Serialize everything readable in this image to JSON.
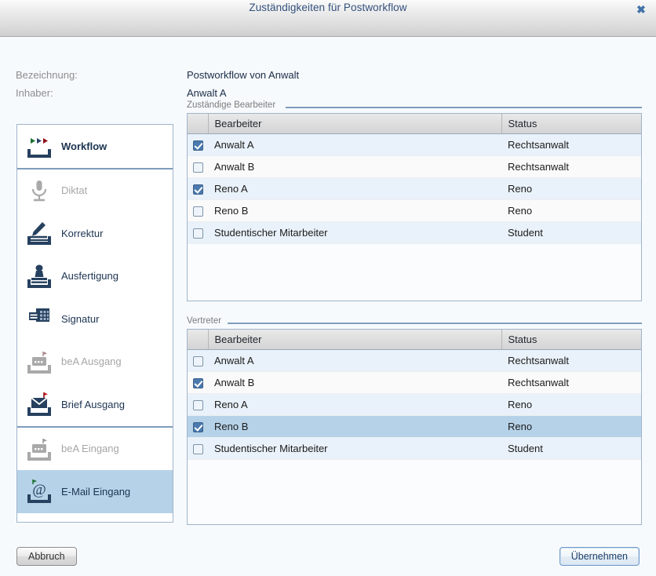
{
  "window": {
    "title": "Zuständigkeiten für Postworkflow",
    "close_icon": "close-icon",
    "close_glyph": "✖"
  },
  "info": {
    "bezeichnung_label": "Bezeichnung:",
    "bezeichnung_value": "Postworkflow von Anwalt",
    "inhaber_label": "Inhaber:",
    "inhaber_value": "Anwalt A"
  },
  "sidebar": {
    "items": [
      {
        "label": "Workflow",
        "icon": "workflow-arrows-icon",
        "state": "active",
        "selected": false,
        "separator_after": true
      },
      {
        "label": "Diktat",
        "icon": "microphone-icon",
        "state": "disabled",
        "selected": false,
        "separator_after": false
      },
      {
        "label": "Korrektur",
        "icon": "pencil-tray-icon",
        "state": "enabled",
        "selected": false,
        "separator_after": false
      },
      {
        "label": "Ausfertigung",
        "icon": "stamp-icon",
        "state": "enabled",
        "selected": false,
        "separator_after": false
      },
      {
        "label": "Signatur",
        "icon": "signature-card-icon",
        "state": "enabled",
        "selected": false,
        "separator_after": false
      },
      {
        "label": "beA Ausgang",
        "icon": "bea-outbox-icon",
        "state": "disabled",
        "selected": false,
        "separator_after": false
      },
      {
        "label": "Brief Ausgang",
        "icon": "envelope-outbox-icon",
        "state": "enabled",
        "selected": false,
        "separator_after": true
      },
      {
        "label": "beA Eingang",
        "icon": "bea-inbox-icon",
        "state": "disabled",
        "selected": false,
        "separator_after": false
      },
      {
        "label": "E-Mail Eingang",
        "icon": "at-inbox-icon",
        "state": "enabled",
        "selected": true,
        "separator_after": false
      }
    ]
  },
  "sections": [
    {
      "title": "Zuständige Bearbeiter",
      "columns": [
        "",
        "Bearbeiter",
        "Status"
      ],
      "rows": [
        {
          "checked": true,
          "bearbeiter": "Anwalt A",
          "status": "Rechtsanwalt",
          "selected": false
        },
        {
          "checked": false,
          "bearbeiter": "Anwalt B",
          "status": "Rechtsanwalt",
          "selected": false
        },
        {
          "checked": true,
          "bearbeiter": "Reno A",
          "status": "Reno",
          "selected": false
        },
        {
          "checked": false,
          "bearbeiter": "Reno B",
          "status": "Reno",
          "selected": false
        },
        {
          "checked": false,
          "bearbeiter": "Studentischer Mitarbeiter",
          "status": "Student",
          "selected": false
        }
      ]
    },
    {
      "title": "Vertreter",
      "columns": [
        "",
        "Bearbeiter",
        "Status"
      ],
      "rows": [
        {
          "checked": false,
          "bearbeiter": "Anwalt A",
          "status": "Rechtsanwalt",
          "selected": false
        },
        {
          "checked": true,
          "bearbeiter": "Anwalt B",
          "status": "Rechtsanwalt",
          "selected": false
        },
        {
          "checked": false,
          "bearbeiter": "Reno A",
          "status": "Reno",
          "selected": false
        },
        {
          "checked": true,
          "bearbeiter": "Reno B",
          "status": "Reno",
          "selected": true
        },
        {
          "checked": false,
          "bearbeiter": "Studentischer Mitarbeiter",
          "status": "Student",
          "selected": false
        }
      ]
    }
  ],
  "footer": {
    "cancel_label": "Abbruch",
    "accept_label": "Übernehmen"
  },
  "colors": {
    "accent_blue": "#4a79ae",
    "selection_blue": "#b6d2e8",
    "row_stripe": "#e9f2fa",
    "rule_blue": "#7e9dbd",
    "icon_navy": "#26405f",
    "icon_gray": "#a9a9a9",
    "title_blue": "#33517d"
  }
}
